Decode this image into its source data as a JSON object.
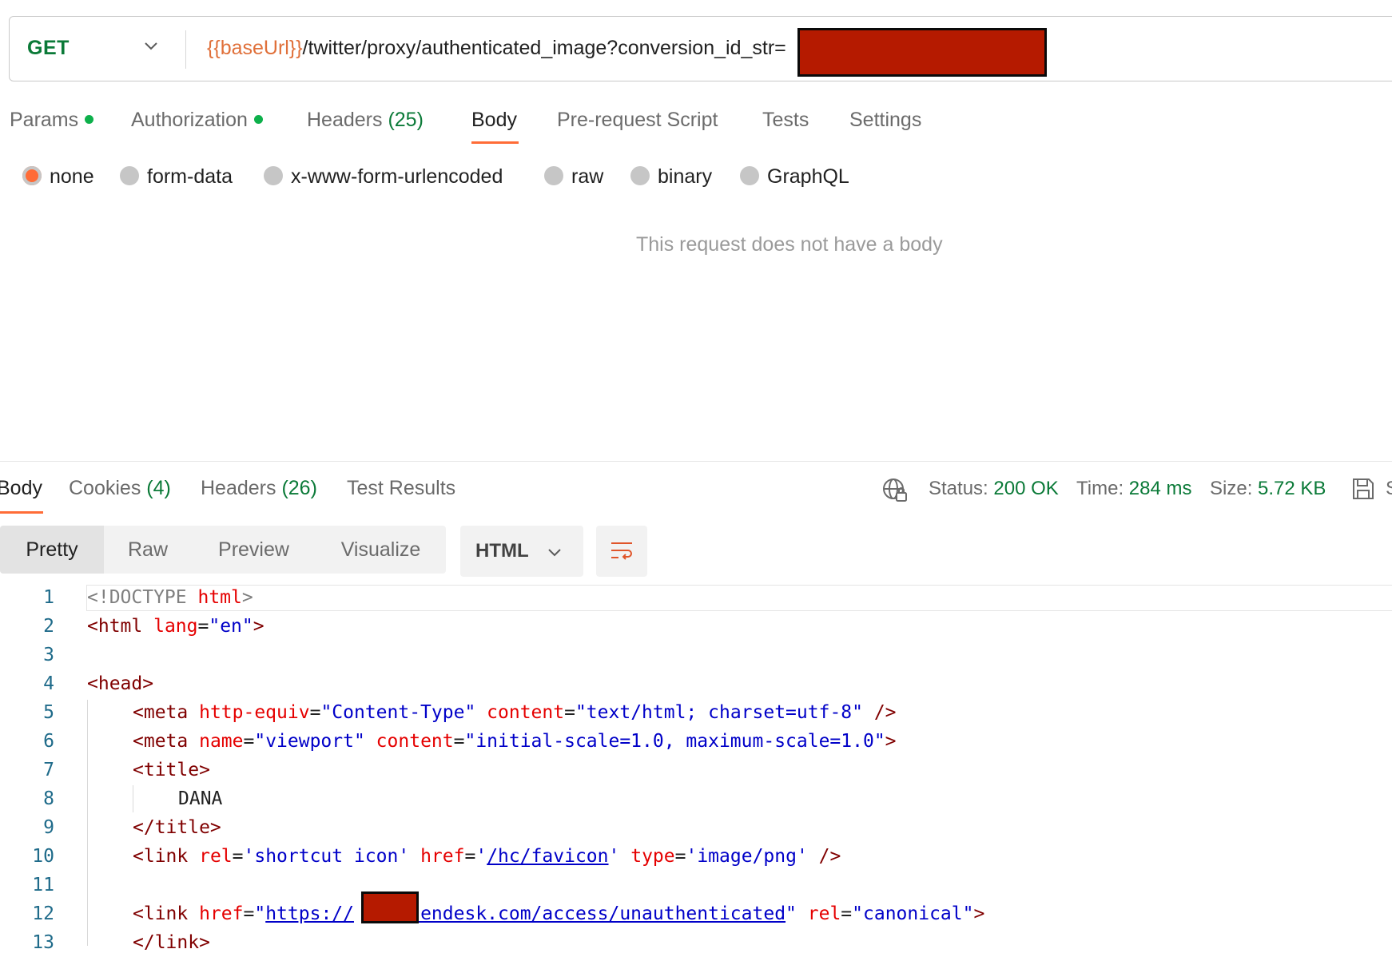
{
  "request": {
    "method": "GET",
    "url_var": "{{baseUrl}}",
    "url_path": "/twitter/proxy/authenticated_image?conversion_id_str="
  },
  "request_tabs": [
    {
      "label": "Params",
      "count": "",
      "dot": true
    },
    {
      "label": "Authorization",
      "count": "",
      "dot": true
    },
    {
      "label": "Headers",
      "count": "(25)",
      "dot": false
    },
    {
      "label": "Body",
      "count": "",
      "dot": false,
      "active": true
    },
    {
      "label": "Pre-request Script",
      "count": "",
      "dot": false
    },
    {
      "label": "Tests",
      "count": "",
      "dot": false
    },
    {
      "label": "Settings",
      "count": "",
      "dot": false
    }
  ],
  "body_types": [
    {
      "label": "none",
      "selected": true
    },
    {
      "label": "form-data",
      "selected": false
    },
    {
      "label": "x-www-form-urlencoded",
      "selected": false
    },
    {
      "label": "raw",
      "selected": false
    },
    {
      "label": "binary",
      "selected": false
    },
    {
      "label": "GraphQL",
      "selected": false
    }
  ],
  "no_body_message": "This request does not have a body",
  "response_tabs": [
    {
      "label": "Body",
      "count": ""
    },
    {
      "label": "Cookies",
      "count": "(4)"
    },
    {
      "label": "Headers",
      "count": "(26)"
    },
    {
      "label": "Test Results",
      "count": ""
    }
  ],
  "status": {
    "status_label": "Status:",
    "status_value": "200 OK",
    "time_label": "Time:",
    "time_value": "284 ms",
    "size_label": "Size:",
    "size_value": "5.72 KB",
    "save_cut": "S"
  },
  "view_modes": [
    "Pretty",
    "Raw",
    "Preview",
    "Visualize"
  ],
  "format": "HTML",
  "colors": {
    "accent": "#ff6c37",
    "success": "#0b7a38",
    "redaction": "#b51a00"
  },
  "icons": [
    "chevron-down-icon",
    "globe-lock-icon",
    "save-icon",
    "wrap-lines-icon"
  ],
  "line_numbers": [
    "1",
    "2",
    "3",
    "4",
    "5",
    "6",
    "7",
    "8",
    "9",
    "10",
    "11",
    "12",
    "13"
  ],
  "code": {
    "l1": {
      "a": "<!DOCTYPE ",
      "b": "html",
      "c": ">"
    },
    "l2": {
      "a": "<html ",
      "b": "lang",
      "c": "=",
      "d": "\"en\"",
      "e": ">"
    },
    "l4": {
      "a": "<head>"
    },
    "l5": {
      "a": "<meta ",
      "b": "http-equiv",
      "c": "=",
      "d": "\"Content-Type\"",
      "e": " content",
      "f": "=",
      "g": "\"text/html; charset=utf-8\"",
      "h": " />"
    },
    "l6": {
      "a": "<meta ",
      "b": "name",
      "c": "=",
      "d": "\"viewport\"",
      "e": " content",
      "f": "=",
      "g": "\"initial-scale=1.0, maximum-scale=1.0\"",
      "h": ">"
    },
    "l7": {
      "a": "<title>"
    },
    "l8": {
      "a": "DANA"
    },
    "l9": {
      "a": "</title>"
    },
    "l10": {
      "a": "<link ",
      "b": "rel",
      "c": "=",
      "d": "'shortcut icon'",
      "e": " href",
      "f": "=",
      "g1": "'",
      "g2": "/hc/favicon",
      "g3": "'",
      "h": " type",
      "i": "=",
      "j": "'image/png'",
      "k": " />"
    },
    "l12": {
      "a": "<link ",
      "b": "href",
      "c": "=",
      "d1": "\"",
      "d2": "https://",
      "d3": "     ",
      "d4": "zendesk.com/access/unauthenticated",
      "d5": "\"",
      "e": " rel",
      "f": "=",
      "g": "\"canonical\"",
      "h": ">"
    },
    "l13": {
      "a": "</link>"
    }
  }
}
